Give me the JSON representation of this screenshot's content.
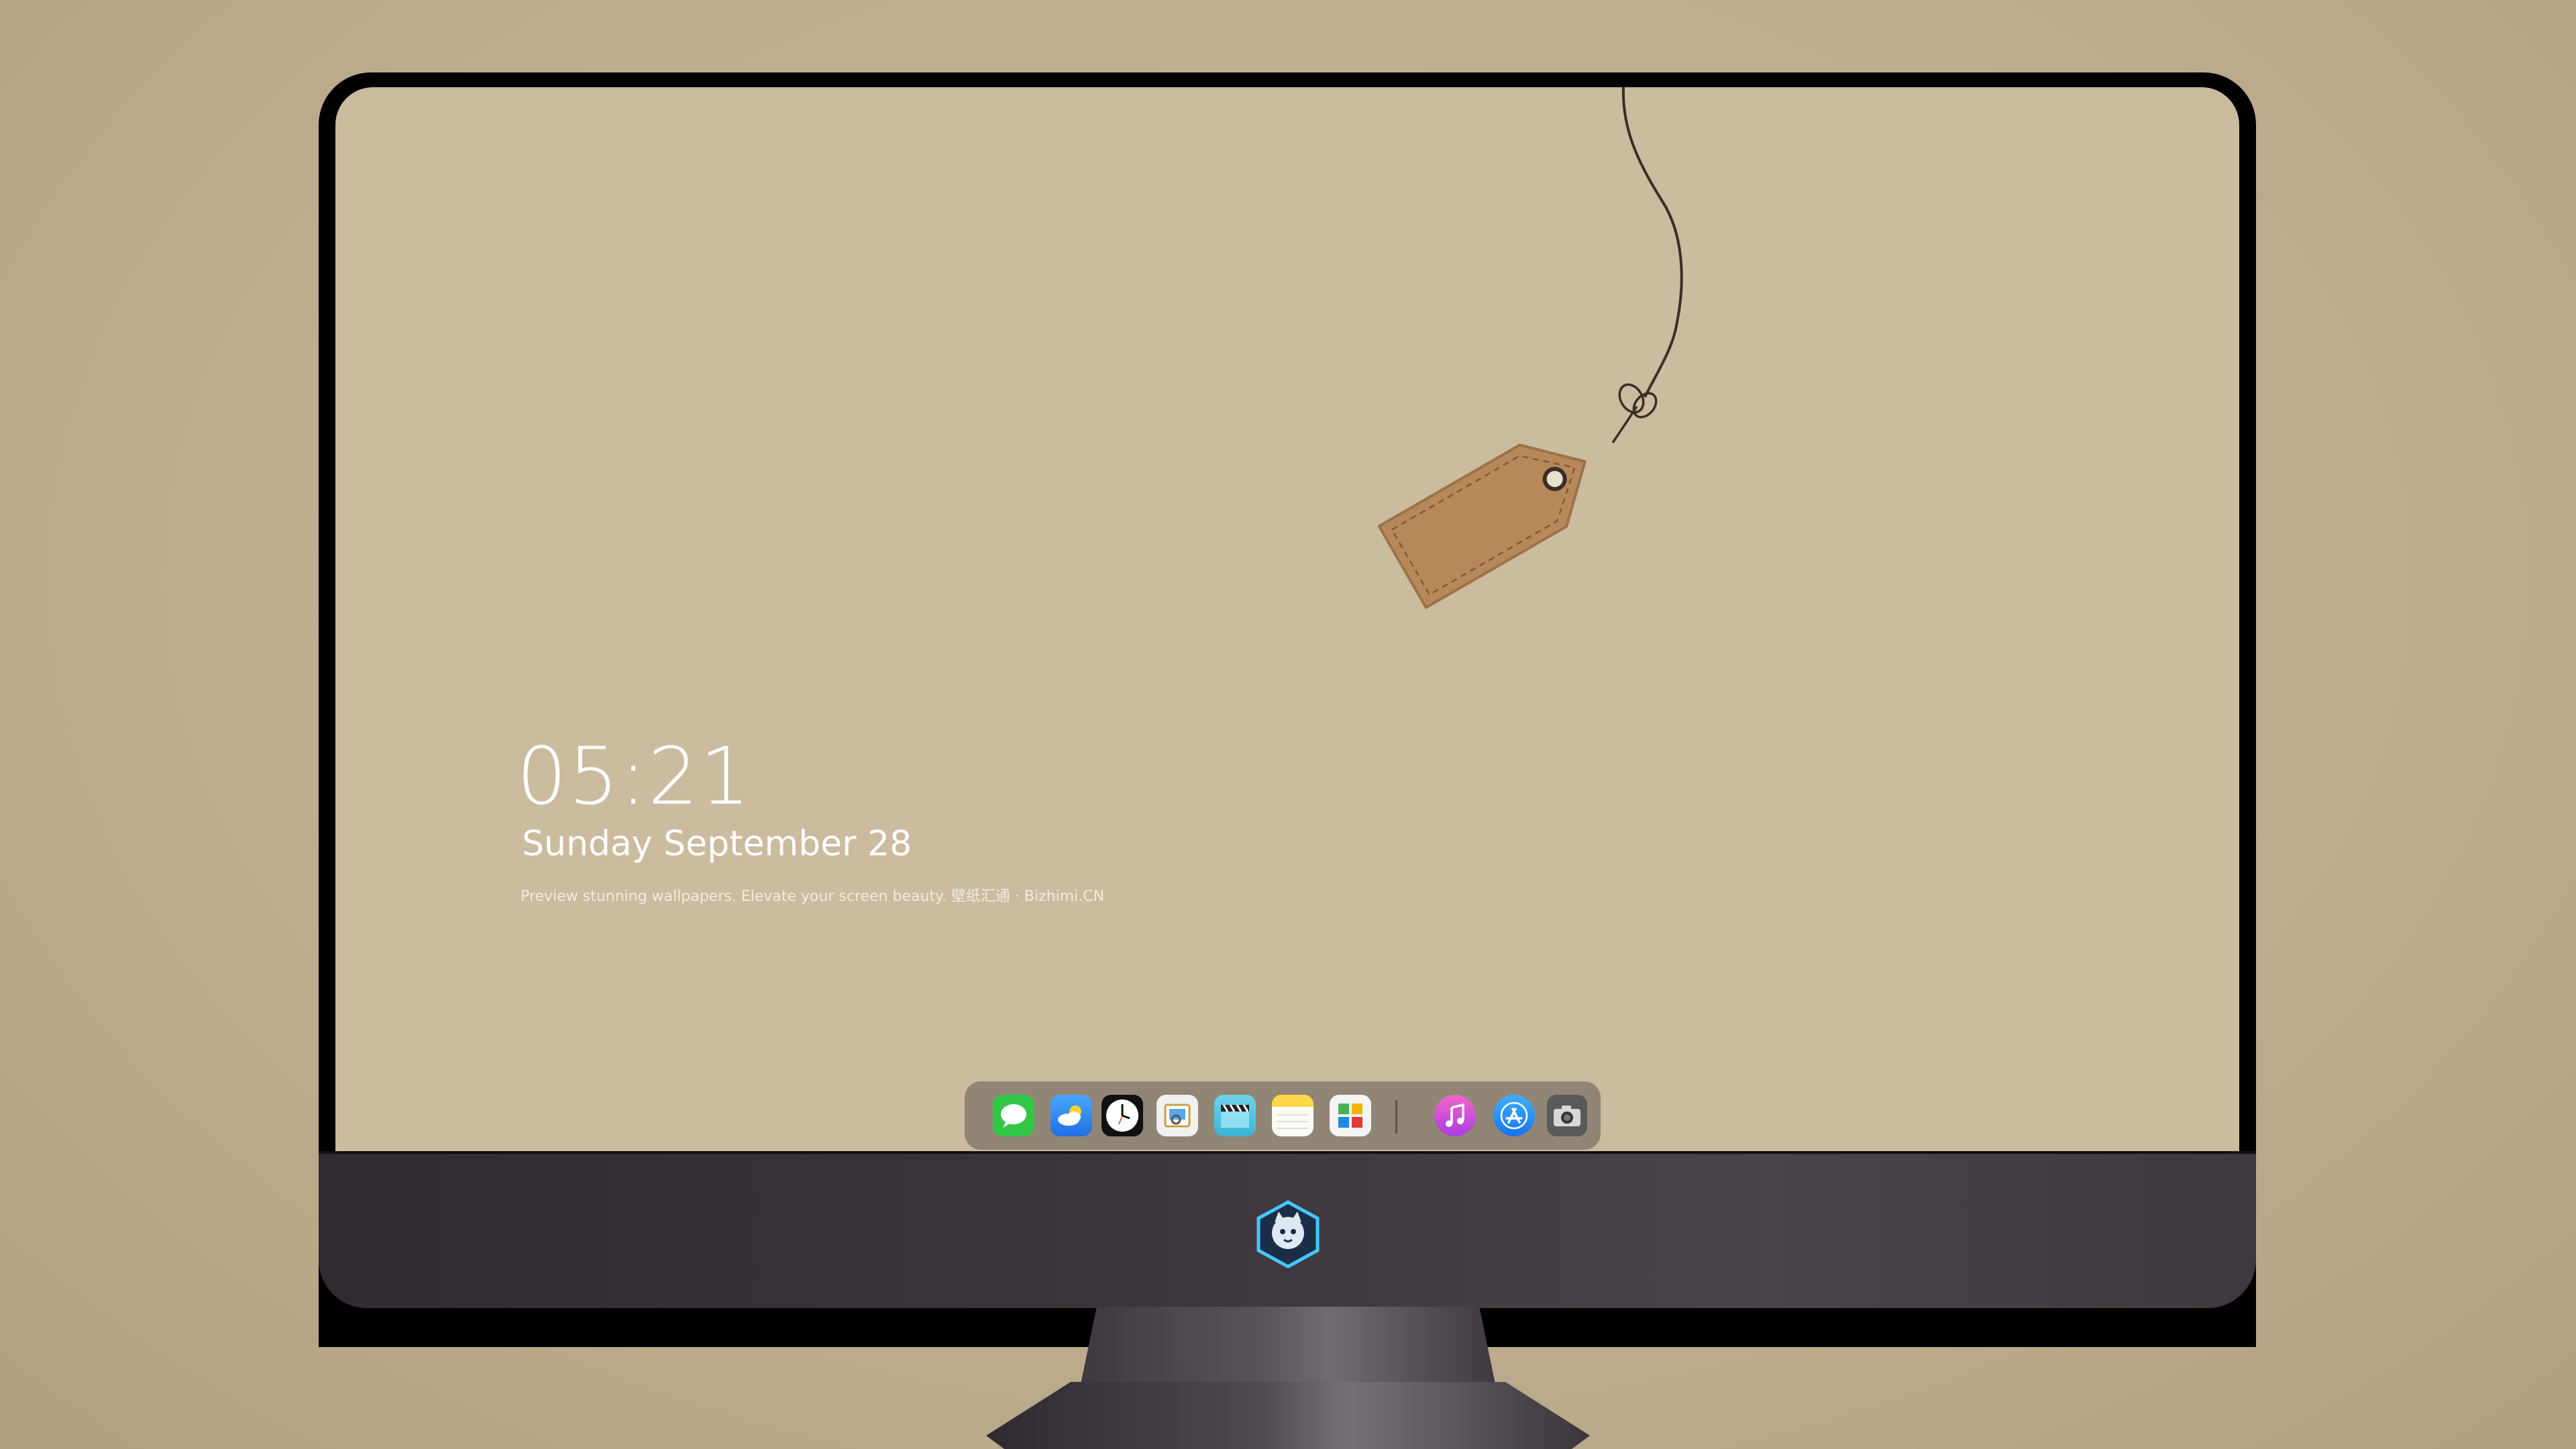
{
  "lock_screen": {
    "time": "05:21",
    "date": "Sunday September  28",
    "caption": "Preview stunning wallpapers. Elevate your screen beauty. 壁纸汇通 · Bizhimi.CN"
  },
  "dock": {
    "apps": [
      {
        "name": "messages-icon",
        "color": "#33c748"
      },
      {
        "name": "weather-icon",
        "color": "#2f8cf0"
      },
      {
        "name": "clock-icon",
        "color": "#111111"
      },
      {
        "name": "preview-icon",
        "color": "#f3f3f3"
      },
      {
        "name": "clips-icon",
        "color": "#5ac8e0"
      },
      {
        "name": "notes-icon",
        "color": "#ffd84a"
      },
      {
        "name": "photos-grid-icon",
        "color": "#f4f4f4"
      },
      {
        "name": "music-icon",
        "color": "#d94fd8"
      },
      {
        "name": "app-store-icon",
        "color": "#1d8cf5"
      },
      {
        "name": "camera-icon",
        "color": "#5a5a5a"
      }
    ]
  },
  "colors": {
    "wallpaper": "#cbbb9f",
    "tag": "#b7895a",
    "bezel": "#000000"
  }
}
